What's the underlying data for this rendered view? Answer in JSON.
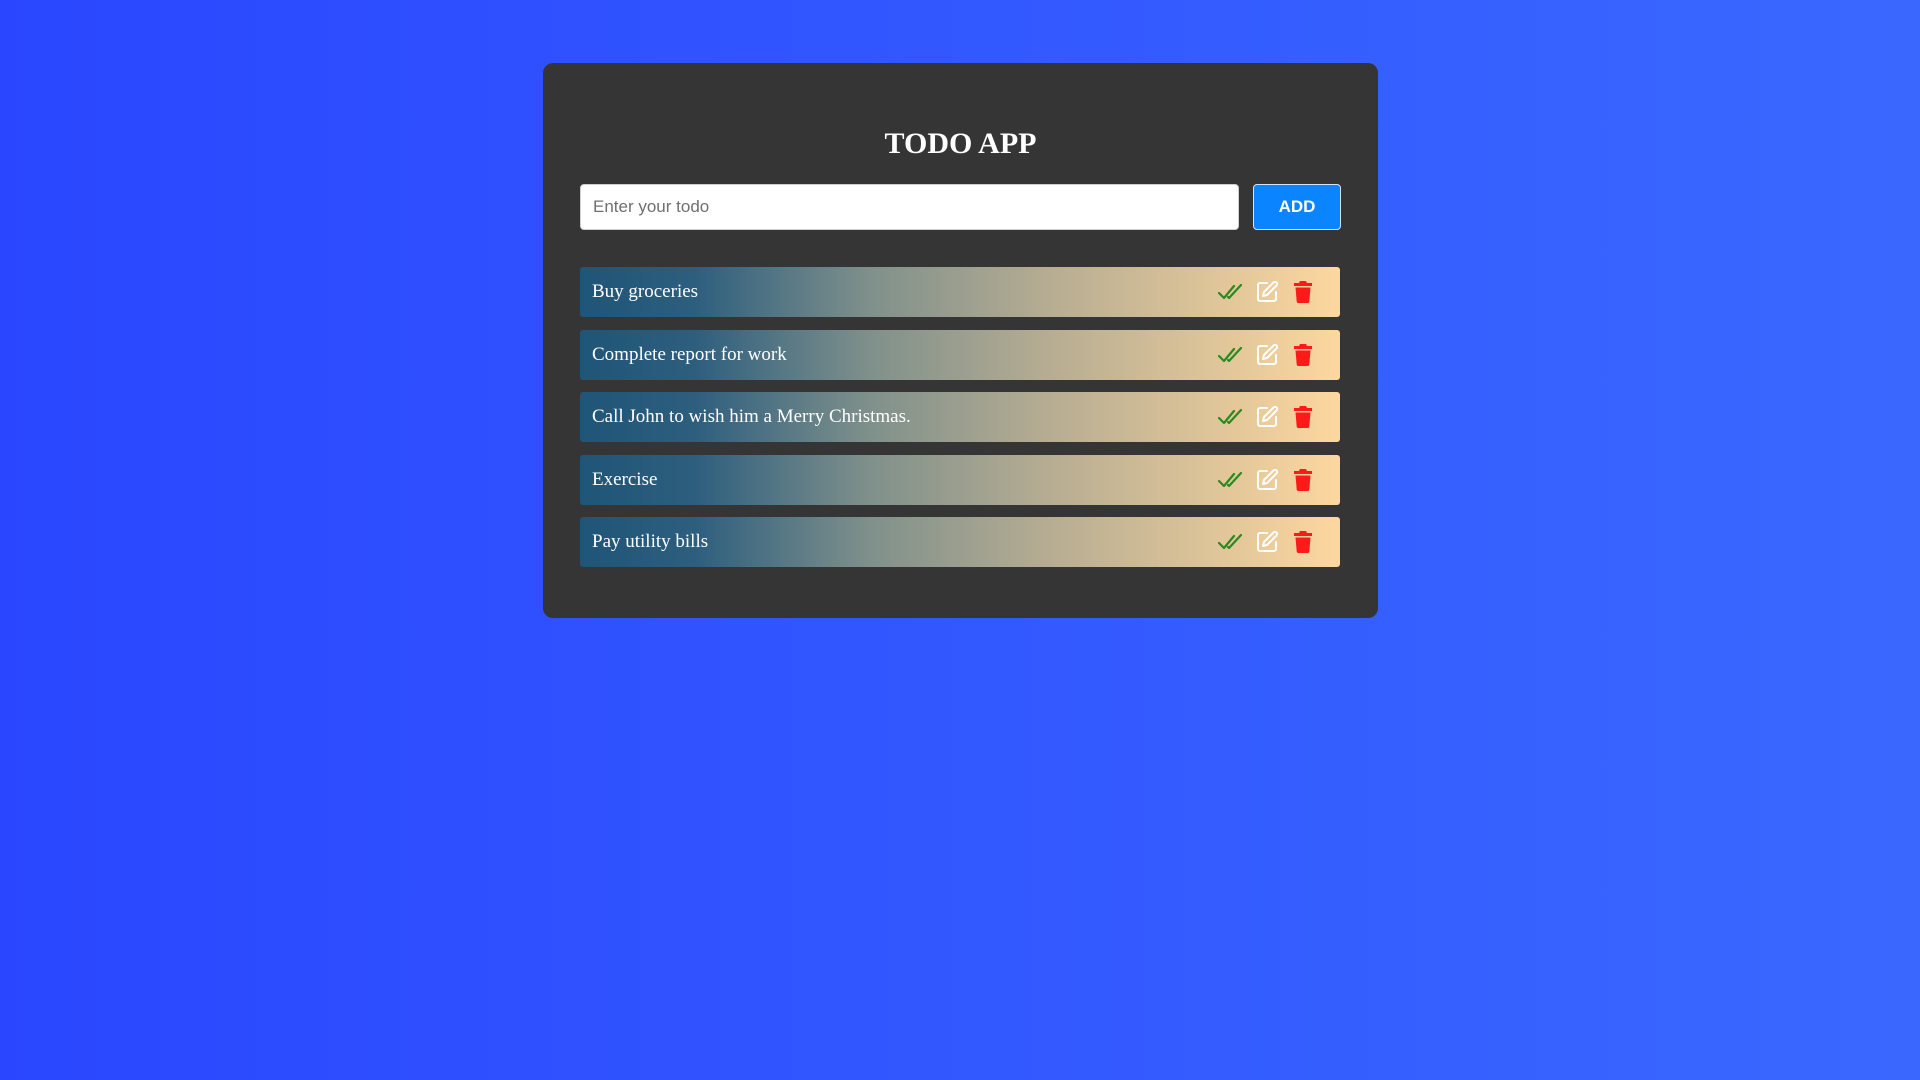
{
  "app": {
    "title": "TODO APP"
  },
  "form": {
    "input_value": "",
    "input_placeholder": "Enter your todo",
    "add_label": "ADD"
  },
  "todos": [
    {
      "text": "Buy groceries"
    },
    {
      "text": "Complete report for work"
    },
    {
      "text": "Call John to wish him a Merry Christmas."
    },
    {
      "text": "Exercise"
    },
    {
      "text": "Pay utility bills"
    }
  ],
  "icons": {
    "complete": "double-check-icon",
    "edit": "edit-icon",
    "delete": "trash-icon"
  },
  "colors": {
    "page_background_start": "#2a47ff",
    "page_background_end": "#3a68ff",
    "card_background": "#353535",
    "add_button": "#0a84ff",
    "check_icon": "#2a8a1f",
    "edit_icon": "#ffffff",
    "delete_icon": "#ff1a1a",
    "item_gradient_start": "#1f5577",
    "item_gradient_end": "#fdd79f"
  }
}
